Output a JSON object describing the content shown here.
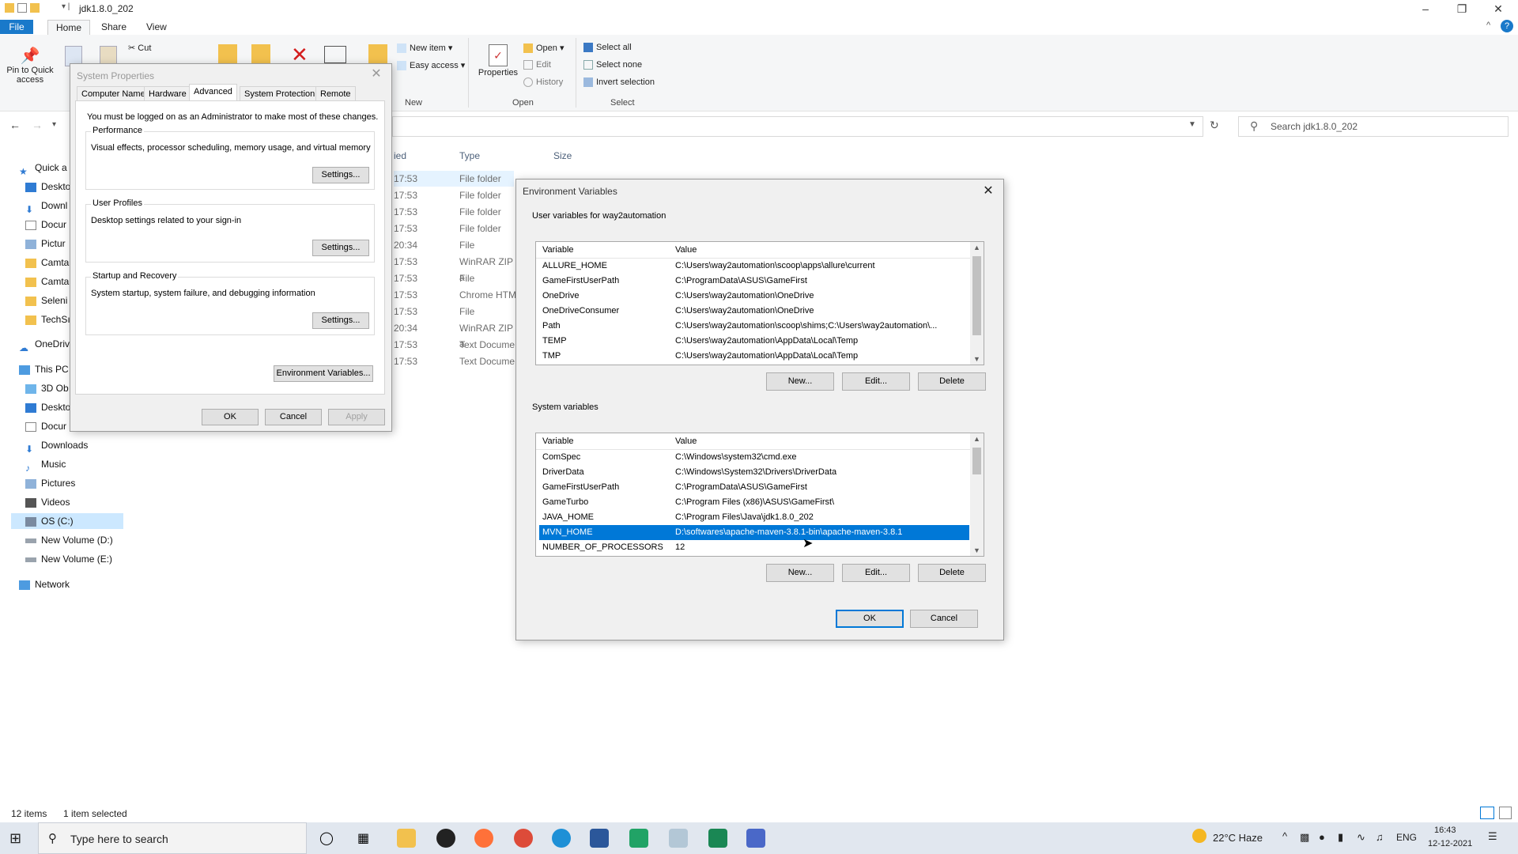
{
  "explorer": {
    "title": "jdk1.8.0_202",
    "tabs": [
      "File",
      "Home",
      "Share",
      "View"
    ],
    "ribbon": {
      "pin_label": "Pin to Quick access",
      "cut": "Cut",
      "new_item": "New item ▾",
      "easy_access": "Easy access ▾",
      "new_group": "New",
      "properties": "Properties",
      "open": "Open ▾",
      "edit": "Edit",
      "history": "History",
      "open_group": "Open",
      "select_all": "Select all",
      "select_none": "Select none",
      "invert_selection": "Invert selection",
      "select_group": "Select"
    },
    "search_placeholder": "Search jdk1.8.0_202",
    "nav": [
      "Quick a",
      "Deskto",
      "Downl",
      "Docur",
      "Pictur",
      "Camta",
      "Camta",
      "Seleni",
      "TechSı",
      "OneDriv",
      "This PC",
      "3D Ob",
      "Deskto",
      "Docur",
      "Downloads",
      "Music",
      "Pictures",
      "Videos",
      "OS (C:)",
      "New Volume (D:)",
      "New Volume (E:)",
      "Network"
    ],
    "columns": {
      "modified": "ied",
      "type": "Type",
      "size": "Size"
    },
    "files": [
      {
        "time": "17:53",
        "type": "File folder"
      },
      {
        "time": "17:53",
        "type": "File folder"
      },
      {
        "time": "17:53",
        "type": "File folder"
      },
      {
        "time": "17:53",
        "type": "File folder"
      },
      {
        "time": "20:34",
        "type": "File"
      },
      {
        "time": "17:53",
        "type": "WinRAR ZIP a"
      },
      {
        "time": "17:53",
        "type": "File"
      },
      {
        "time": "17:53",
        "type": "Chrome HTM"
      },
      {
        "time": "17:53",
        "type": "File"
      },
      {
        "time": "20:34",
        "type": "WinRAR ZIP a"
      },
      {
        "time": "17:53",
        "type": "Text Docume"
      },
      {
        "time": "17:53",
        "type": "Text Docume"
      }
    ],
    "status_items": "12 items",
    "status_selected": "1 item selected"
  },
  "sysprops": {
    "title": "System Properties",
    "tabs": [
      "Computer Name",
      "Hardware",
      "Advanced",
      "System Protection",
      "Remote"
    ],
    "admin_note": "You must be logged on as an Administrator to make most of these changes.",
    "performance": {
      "label": "Performance",
      "desc": "Visual effects, processor scheduling, memory usage, and virtual memory",
      "button": "Settings..."
    },
    "user_profiles": {
      "label": "User Profiles",
      "desc": "Desktop settings related to your sign-in",
      "button": "Settings..."
    },
    "startup": {
      "label": "Startup and Recovery",
      "desc": "System startup, system failure, and debugging information",
      "button": "Settings..."
    },
    "env_button": "Environment Variables...",
    "ok": "OK",
    "cancel": "Cancel",
    "apply": "Apply"
  },
  "envvars": {
    "title": "Environment Variables",
    "user_label": "User variables for way2automation",
    "col_variable": "Variable",
    "col_value": "Value",
    "user_vars": [
      {
        "name": "ALLURE_HOME",
        "value": "C:\\Users\\way2automation\\scoop\\apps\\allure\\current"
      },
      {
        "name": "GameFirstUserPath",
        "value": "C:\\ProgramData\\ASUS\\GameFirst"
      },
      {
        "name": "OneDrive",
        "value": "C:\\Users\\way2automation\\OneDrive"
      },
      {
        "name": "OneDriveConsumer",
        "value": "C:\\Users\\way2automation\\OneDrive"
      },
      {
        "name": "Path",
        "value": "C:\\Users\\way2automation\\scoop\\shims;C:\\Users\\way2automation\\..."
      },
      {
        "name": "TEMP",
        "value": "C:\\Users\\way2automation\\AppData\\Local\\Temp"
      },
      {
        "name": "TMP",
        "value": "C:\\Users\\way2automation\\AppData\\Local\\Temp"
      }
    ],
    "system_label": "System variables",
    "system_vars": [
      {
        "name": "ComSpec",
        "value": "C:\\Windows\\system32\\cmd.exe"
      },
      {
        "name": "DriverData",
        "value": "C:\\Windows\\System32\\Drivers\\DriverData"
      },
      {
        "name": "GameFirstUserPath",
        "value": "C:\\ProgramData\\ASUS\\GameFirst"
      },
      {
        "name": "GameTurbo",
        "value": "C:\\Program Files (x86)\\ASUS\\GameFirst\\"
      },
      {
        "name": "JAVA_HOME",
        "value": "C:\\Program Files\\Java\\jdk1.8.0_202"
      },
      {
        "name": "MVN_HOME",
        "value": "D:\\softwares\\apache-maven-3.8.1-bin\\apache-maven-3.8.1"
      },
      {
        "name": "NUMBER_OF_PROCESSORS",
        "value": "12"
      }
    ],
    "new": "New...",
    "edit": "Edit...",
    "delete": "Delete",
    "ok": "OK",
    "cancel": "Cancel"
  },
  "taskbar": {
    "search_placeholder": "Type here to search",
    "weather": "22°C  Haze",
    "lang": "ENG",
    "time": "16:43",
    "date": "12-12-2021"
  }
}
